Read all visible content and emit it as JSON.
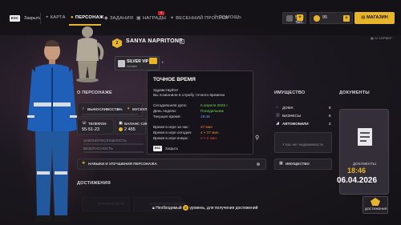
{
  "topbar": {
    "esc_key": "ESC",
    "esc_label": "Закрыть",
    "nav": [
      {
        "label": "КАРТА",
        "icon": "map-icon"
      },
      {
        "label": "ПЕРСОНАЖ",
        "icon": "person-icon"
      },
      {
        "label": "ЗАДАНИЯ",
        "icon": "quest-icon"
      },
      {
        "label": "НАГРАДЫ",
        "icon": "gift-icon"
      },
      {
        "label": "ВЕСЕННИЙ ПРОПУСК",
        "icon": "pass-icon"
      },
      {
        "label": "ПОМОЩЬ",
        "icon": "help-icon"
      }
    ],
    "rewards_badge": "3",
    "money": "59.8 тыс.",
    "coins": "95",
    "shop_label": "МАГАЗИН"
  },
  "profile": {
    "name": "SANYA NAPRITONE",
    "vip_level": "2",
    "status_label": "SILVER VIP",
    "status_sub": "Активен",
    "server": "12 СЕРВЕР"
  },
  "about": {
    "section_title": "О ПЕРСОНАЖЕ",
    "stats": [
      {
        "label": "ВЫНОСЛИВОСТЬ",
        "value": "0%"
      },
      {
        "label": "МУСКУЛЫ",
        "value": ""
      }
    ],
    "phone_label": "ТЕЛЕФОН",
    "phone_value": "55-51-23",
    "sim_label": "БАЛАНС СИМ-КА",
    "sim_value": "2 465",
    "law_label": "ЗАКОНОПОСЛУШНОСТЬ",
    "fear_label": "БЕЗОПАСНОСТЬ",
    "skills_label": "НАВЫКИ И УЛУЧШЕНИЯ ПЕРСОНАЖА"
  },
  "tooltip": {
    "title": "ТОЧНОЕ ВРЕМЯ",
    "greeting": "Здравствуйте!",
    "greeting2": "Вы позвонили в службу точного времени",
    "rows1": [
      {
        "label": "Сегодняшняя дата:",
        "value": "6 апреля 2026 г."
      },
      {
        "label": "День недели:",
        "value": "Понедельник"
      },
      {
        "label": "Текущее время:",
        "value": "18:46"
      }
    ],
    "rows2": [
      {
        "label": "Время в игре за час:",
        "value": "27 мин"
      },
      {
        "label": "Время в игре сегодня:",
        "value": "4 ч 37 мин"
      },
      {
        "label": "Время в игре вчера:",
        "value": "0 ч 0 мин"
      }
    ],
    "esc_key": "ESC",
    "esc_label": "Закрыть"
  },
  "property": {
    "section_title": "ИМУЩЕСТВО",
    "items": [
      {
        "label": "ДОМА",
        "count": "0"
      },
      {
        "label": "БИЗНЕСЫ",
        "count": "0"
      },
      {
        "label": "АВТОМОБИЛИ",
        "count": "2"
      }
    ],
    "empty_text": "У вас нет недвижимости",
    "button_label": "ИМУЩЕСТВО"
  },
  "documents": {
    "section_title": "ДОКУМЕНТЫ",
    "doc_label": "ДОКУМЕНТЫ",
    "time": "18:46",
    "date": "06.04.2026"
  },
  "achievements": {
    "section_title": "ДОСТИЖЕНИЯ",
    "required_text": "Необходимый",
    "required_text2": "уровень, для получения достижений",
    "level_icon": "2",
    "button_label": "ДОСТИЖЕНИЯ",
    "hidden_left": "ВРЕМЯ В ИГРЕ",
    "hidden_mid": "ЗАРАБОТАНО ДЕНЕГ"
  },
  "colors": {
    "accent": "#e8b52a",
    "panel": "#28242c",
    "time_green": "#6bd84c",
    "time_orange": "#f08c2a",
    "time_red": "#e8412a",
    "time_blue": "#6aa6ff"
  }
}
